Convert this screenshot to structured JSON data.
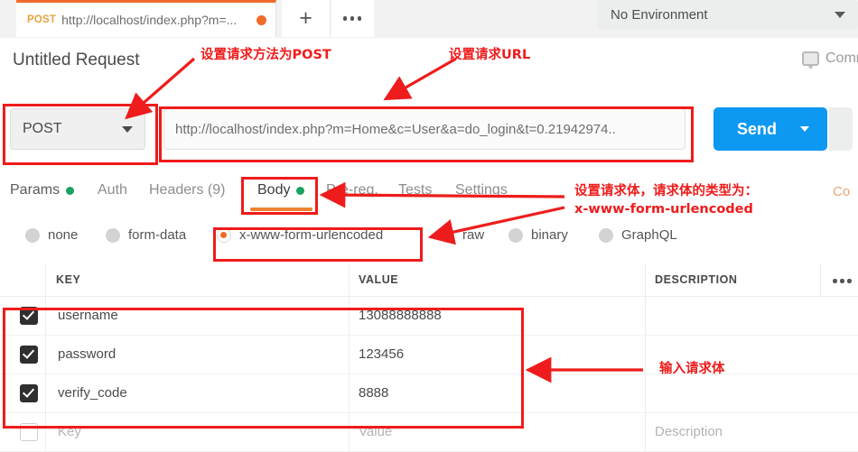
{
  "tabstrip": {
    "request_tab": {
      "method": "POST",
      "url": "http://localhost/index.php?m=...",
      "unsaved_icon": "unsaved-dot"
    },
    "new_tab_icon": "plus-icon",
    "more_tabs_icon": "ellipsis-icon",
    "environment": {
      "value": "No Environment",
      "caret_icon": "chevron-down-icon"
    }
  },
  "header": {
    "request_title": "Untitled Request",
    "comments_label": "Comm",
    "comments_icon": "comment-icon"
  },
  "urlbar": {
    "method": "POST",
    "method_caret_icon": "chevron-down-icon",
    "url": "http://localhost/index.php?m=Home&c=User&a=do_login&t=0.21942974..",
    "send_label": "Send",
    "send_caret_icon": "chevron-down-icon"
  },
  "tabs": [
    {
      "label": "Params",
      "dot": "●",
      "active": false
    },
    {
      "label": "Auth",
      "dot": "",
      "active": false
    },
    {
      "label": "Headers (9)",
      "dot": "",
      "active": false
    },
    {
      "label": "Body",
      "dot": "●",
      "active": true
    },
    {
      "label": "Pre-req.",
      "dot": "",
      "active": false
    },
    {
      "label": "Tests",
      "dot": "",
      "active": false
    },
    {
      "label": "Settings",
      "dot": "",
      "active": false
    }
  ],
  "cookies_link": "Co",
  "body_types": [
    {
      "label": "none",
      "selected": false
    },
    {
      "label": "form-data",
      "selected": false
    },
    {
      "label": "x-www-form-urlencoded",
      "selected": true
    },
    {
      "label": "raw",
      "selected": false
    },
    {
      "label": "binary",
      "selected": false
    },
    {
      "label": "GraphQL",
      "selected": false
    }
  ],
  "table": {
    "headers": {
      "key": "KEY",
      "value": "VALUE",
      "description": "DESCRIPTION",
      "menu_icon": "ellipsis-icon"
    },
    "rows": [
      {
        "checked": true,
        "key": "username",
        "value": "13088888888",
        "description": ""
      },
      {
        "checked": true,
        "key": "password",
        "value": "123456",
        "description": ""
      },
      {
        "checked": true,
        "key": "verify_code",
        "value": "8888",
        "description": ""
      }
    ],
    "placeholder_row": {
      "checked": false,
      "key": "Key",
      "value": "Value",
      "description": "Description"
    }
  },
  "annotations": {
    "method_note": "设置请求方法为POST",
    "url_note": "设置请求URL",
    "body_note_line1": "设置请求体，请求体的类型为：",
    "body_note_line2": "x-www-form-urlencoded",
    "table_note": "输入请求体"
  },
  "colors": {
    "accent_orange": "#ef6c2b",
    "send_blue": "#0d99f2",
    "annotation_red": "#ee1c1c",
    "status_green": "#1aa260"
  }
}
